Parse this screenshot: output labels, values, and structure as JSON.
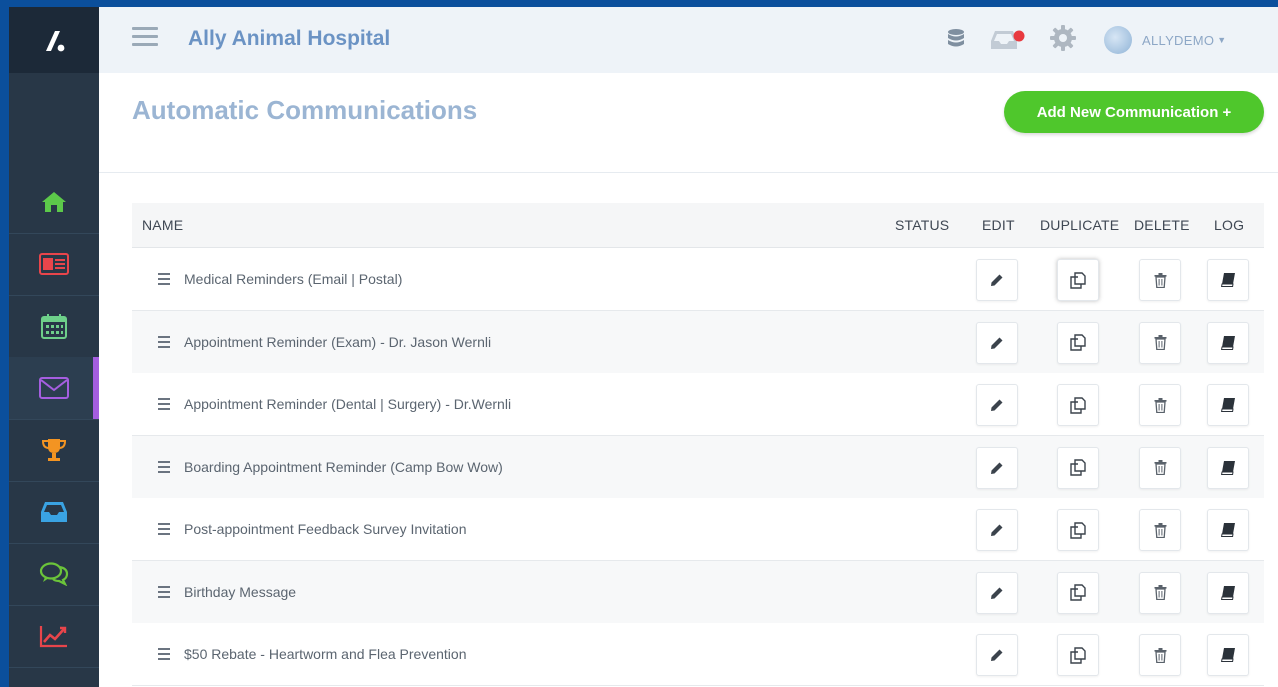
{
  "app": {
    "clinic_name": "Ally Animal Hospital",
    "user": "ALLYDEMO"
  },
  "page": {
    "title": "Automatic Communications",
    "add_button": "Add New Communication +"
  },
  "table": {
    "headers": {
      "name": "NAME",
      "status": "STATUS",
      "edit": "EDIT",
      "duplicate": "DUPLICATE",
      "delete": "DELETE",
      "log": "LOG"
    },
    "rows": [
      {
        "name": "Medical Reminders (Email | Postal)"
      },
      {
        "name": "Appointment Reminder (Exam) - Dr. Jason Wernli"
      },
      {
        "name": "Appointment Reminder (Dental | Surgery) - Dr.Wernli"
      },
      {
        "name": "Boarding Appointment Reminder (Camp Bow Wow)"
      },
      {
        "name": "Post-appointment Feedback Survey Invitation"
      },
      {
        "name": "Birthday Message"
      },
      {
        "name": "$50 Rebate - Heartworm and Flea Prevention"
      }
    ]
  },
  "sidebar": {
    "items": [
      {
        "icon": "home-icon",
        "color": "#5cc94a"
      },
      {
        "icon": "contact-card-icon",
        "color": "#e8454b"
      },
      {
        "icon": "calendar-icon",
        "color": "#6ed08a"
      },
      {
        "icon": "envelope-icon",
        "color": "#a55ee0"
      },
      {
        "icon": "trophy-icon",
        "color": "#f39422"
      },
      {
        "icon": "inbox-icon",
        "color": "#3aa3e3"
      },
      {
        "icon": "chat-bubbles-icon",
        "color": "#6bc43a"
      },
      {
        "icon": "line-chart-icon",
        "color": "#e8454b"
      }
    ]
  },
  "colors": {
    "accent_green": "#4fc72c",
    "title_blue": "#9bb5d3",
    "clinic_blue": "#6b93c4",
    "sidebar_bg": "#283747",
    "active_marker": "#a55ee0"
  }
}
